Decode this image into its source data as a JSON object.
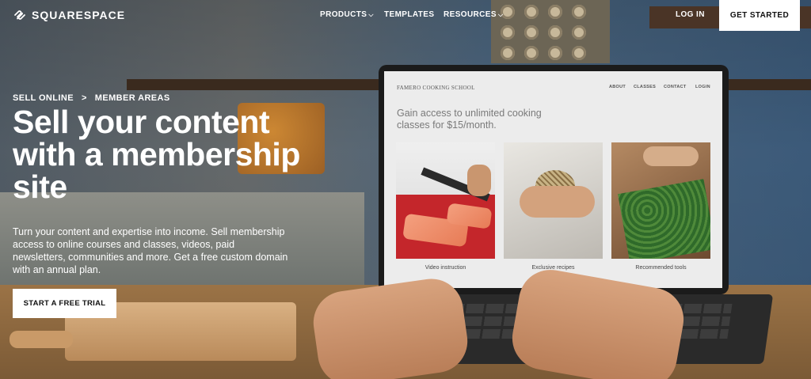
{
  "nav": {
    "brand": "SQUARESPACE",
    "items": [
      {
        "label": "PRODUCTS",
        "has_dropdown": true
      },
      {
        "label": "TEMPLATES",
        "has_dropdown": false
      },
      {
        "label": "RESOURCES",
        "has_dropdown": true
      }
    ],
    "login": "LOG IN",
    "get_started": "GET STARTED"
  },
  "hero": {
    "breadcrumb": [
      "SELL ONLINE",
      "MEMBER AREAS"
    ],
    "breadcrumb_separator": ">",
    "headline": "Sell your content with a membership site",
    "subcopy": "Turn your content and expertise into income. Sell membership access to online courses and classes, videos, paid newsletters, communities and more. Get a free custom domain with an annual plan.",
    "cta": "START A FREE TRIAL"
  },
  "laptop_site": {
    "brand": "FAMERO COOKING SCHOOL",
    "nav": [
      "ABOUT",
      "CLASSES",
      "CONTACT",
      "LOGIN"
    ],
    "headline": "Gain access to unlimited cooking classes for $15/month.",
    "cards": [
      {
        "caption": "Video instruction"
      },
      {
        "caption": "Exclusive recipes"
      },
      {
        "caption": "Recommended tools"
      }
    ]
  },
  "icons": {
    "logo": "squarespace-logo-icon",
    "dropdown": "chevron-down-icon"
  },
  "colors": {
    "nav_text": "#ffffff",
    "button_bg": "#ffffff",
    "button_text": "#111111",
    "laptop_screen_bg": "#ececec"
  }
}
